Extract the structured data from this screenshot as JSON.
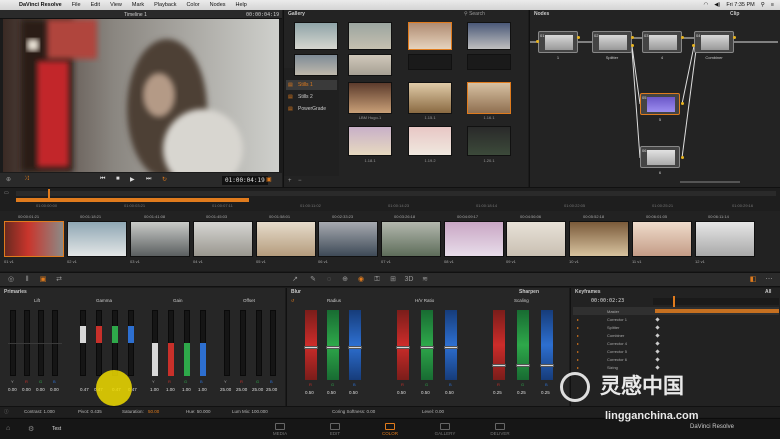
{
  "menubar": {
    "app": "DaVinci Resolve",
    "items": [
      "File",
      "Edit",
      "View",
      "Mark",
      "Playback",
      "Color",
      "Nodes",
      "Help"
    ],
    "clock": "Fri 7:35 PM"
  },
  "viewer": {
    "title": "Timeline 1",
    "timecode_top": "00:00:04:19",
    "timecode": "01:00:04:19"
  },
  "gallery": {
    "title": "Gallery",
    "search": "Search",
    "albums": [
      "Stills 1",
      "Stills 2",
      "PowerGrade"
    ],
    "stills": [
      {
        "label": "1.1.1"
      },
      {
        "label": "1.2.1"
      },
      {
        "label": "1.3.1"
      },
      {
        "label": "1.4.1"
      },
      {
        "label": "1.5.1"
      },
      {
        "label": "1.6.1"
      },
      {
        "label": "LBM\nHugo-1"
      },
      {
        "label": "1.15.1"
      },
      {
        "label": "1.16.1"
      },
      {
        "label": "1.18.1"
      },
      {
        "label": "1.19.2"
      },
      {
        "label": "1.20.1"
      }
    ]
  },
  "nodes": {
    "title": "Nodes",
    "mode": "Clip",
    "items": [
      {
        "num": "01",
        "label": "1"
      },
      {
        "num": "02",
        "label": "Splitter"
      },
      {
        "num": "03",
        "label": "4"
      },
      {
        "num": "04",
        "label": "Combiner"
      },
      {
        "num": "05",
        "label": "5"
      },
      {
        "num": "06",
        "label": "6"
      }
    ]
  },
  "timeline": {
    "ruler": [
      "01:00:00:00",
      "01:00:03:21",
      "01:00:07:11",
      "01:00:11:02",
      "01:00:14:23",
      "01:00:18:14",
      "01:00:22:05",
      "01:00:25:21",
      "01:00:29:16"
    ],
    "ruler2": [
      "01:00:00:00",
      "01:00:03:21",
      "01:00:07:11",
      "01:00:11:02",
      "01:00:14:23",
      "01:00:18:14",
      "01:00:22:05",
      "01:00:25:21",
      "01:00:29:16"
    ]
  },
  "clips": [
    {
      "num": "01",
      "tc": "00:00:01:21",
      "v": "v1"
    },
    {
      "num": "02",
      "tc": "00:01:18:21",
      "v": "v1"
    },
    {
      "num": "03",
      "tc": "00:01:41:08",
      "v": "v1"
    },
    {
      "num": "04",
      "tc": "00:01:45:03",
      "v": "v1"
    },
    {
      "num": "05",
      "tc": "00:01:58:01",
      "v": "v1"
    },
    {
      "num": "06",
      "tc": "00:02:33:23",
      "v": "v1"
    },
    {
      "num": "07",
      "tc": "00:03:26:18",
      "v": "v1"
    },
    {
      "num": "08",
      "tc": "00:04:09:17",
      "v": "v1"
    },
    {
      "num": "09",
      "tc": "00:04:56:06",
      "v": "v1"
    },
    {
      "num": "10",
      "tc": "00:05:52:18",
      "v": "v1"
    },
    {
      "num": "11",
      "tc": "00:06:01:05",
      "v": "v1"
    },
    {
      "num": "12",
      "tc": "00:06:11:14",
      "v": "v1"
    }
  ],
  "primaries": {
    "title": "Primaries",
    "groups": [
      {
        "name": "Lift",
        "values": [
          "0.00",
          "0.00",
          "0.00",
          "0.00"
        ]
      },
      {
        "name": "Gamma",
        "values": [
          "0.47",
          "0.47",
          "0.47",
          "0.47"
        ]
      },
      {
        "name": "Gain",
        "values": [
          "1.00",
          "1.00",
          "1.00",
          "1.00"
        ]
      },
      {
        "name": "Offset",
        "values": [
          "25.00",
          "25.00",
          "25.00",
          "25.00"
        ]
      }
    ],
    "channels": [
      "Y",
      "R",
      "G",
      "B"
    ]
  },
  "blur": {
    "title": "Blur",
    "mode_title": "Sharpen",
    "groups": [
      {
        "name": "Radius",
        "values": [
          "0.50",
          "0.50",
          "0.50"
        ]
      },
      {
        "name": "H/V Ratio",
        "values": [
          "0.50",
          "0.50",
          "0.50"
        ]
      },
      {
        "name": "Scaling",
        "values": [
          "0.25",
          "0.25",
          "0.25"
        ]
      }
    ],
    "channels": [
      "R",
      "G",
      "B"
    ],
    "radius_row": [
      "0.50",
      "0.50",
      "0.50"
    ]
  },
  "keyframes": {
    "title": "Keyframes",
    "mode": "All",
    "timecode": "00:00:02:23",
    "rows": [
      "Master",
      "Corrector 1",
      "Splitter",
      "Combiner",
      "Corrector 4",
      "Corrector 5",
      "Corrector 6",
      "Sizing"
    ]
  },
  "status": {
    "contrast": "Contrast: 1.000",
    "pivot": "Pivot: 0.435",
    "saturation_label": "Saturation:",
    "saturation": "50.00",
    "hue": "Hue: 50.000",
    "lummix": "Lum Mix: 100.000",
    "coring": "Coring Softness: 0.00",
    "level": "Level: 0.00"
  },
  "pagebar": {
    "project": "Test",
    "pages": [
      "MEDIA",
      "EDIT",
      "COLOR",
      "GALLERY",
      "DELIVER"
    ],
    "active": "COLOR"
  },
  "watermark": {
    "big": "灵感中国",
    "url": "lingganchina.com",
    "res": "DaVinci Resolve"
  },
  "colors": {
    "accent": "#e07b1d",
    "red": "#c8302a",
    "green": "#2ea84a",
    "blue": "#2d6fd0"
  }
}
